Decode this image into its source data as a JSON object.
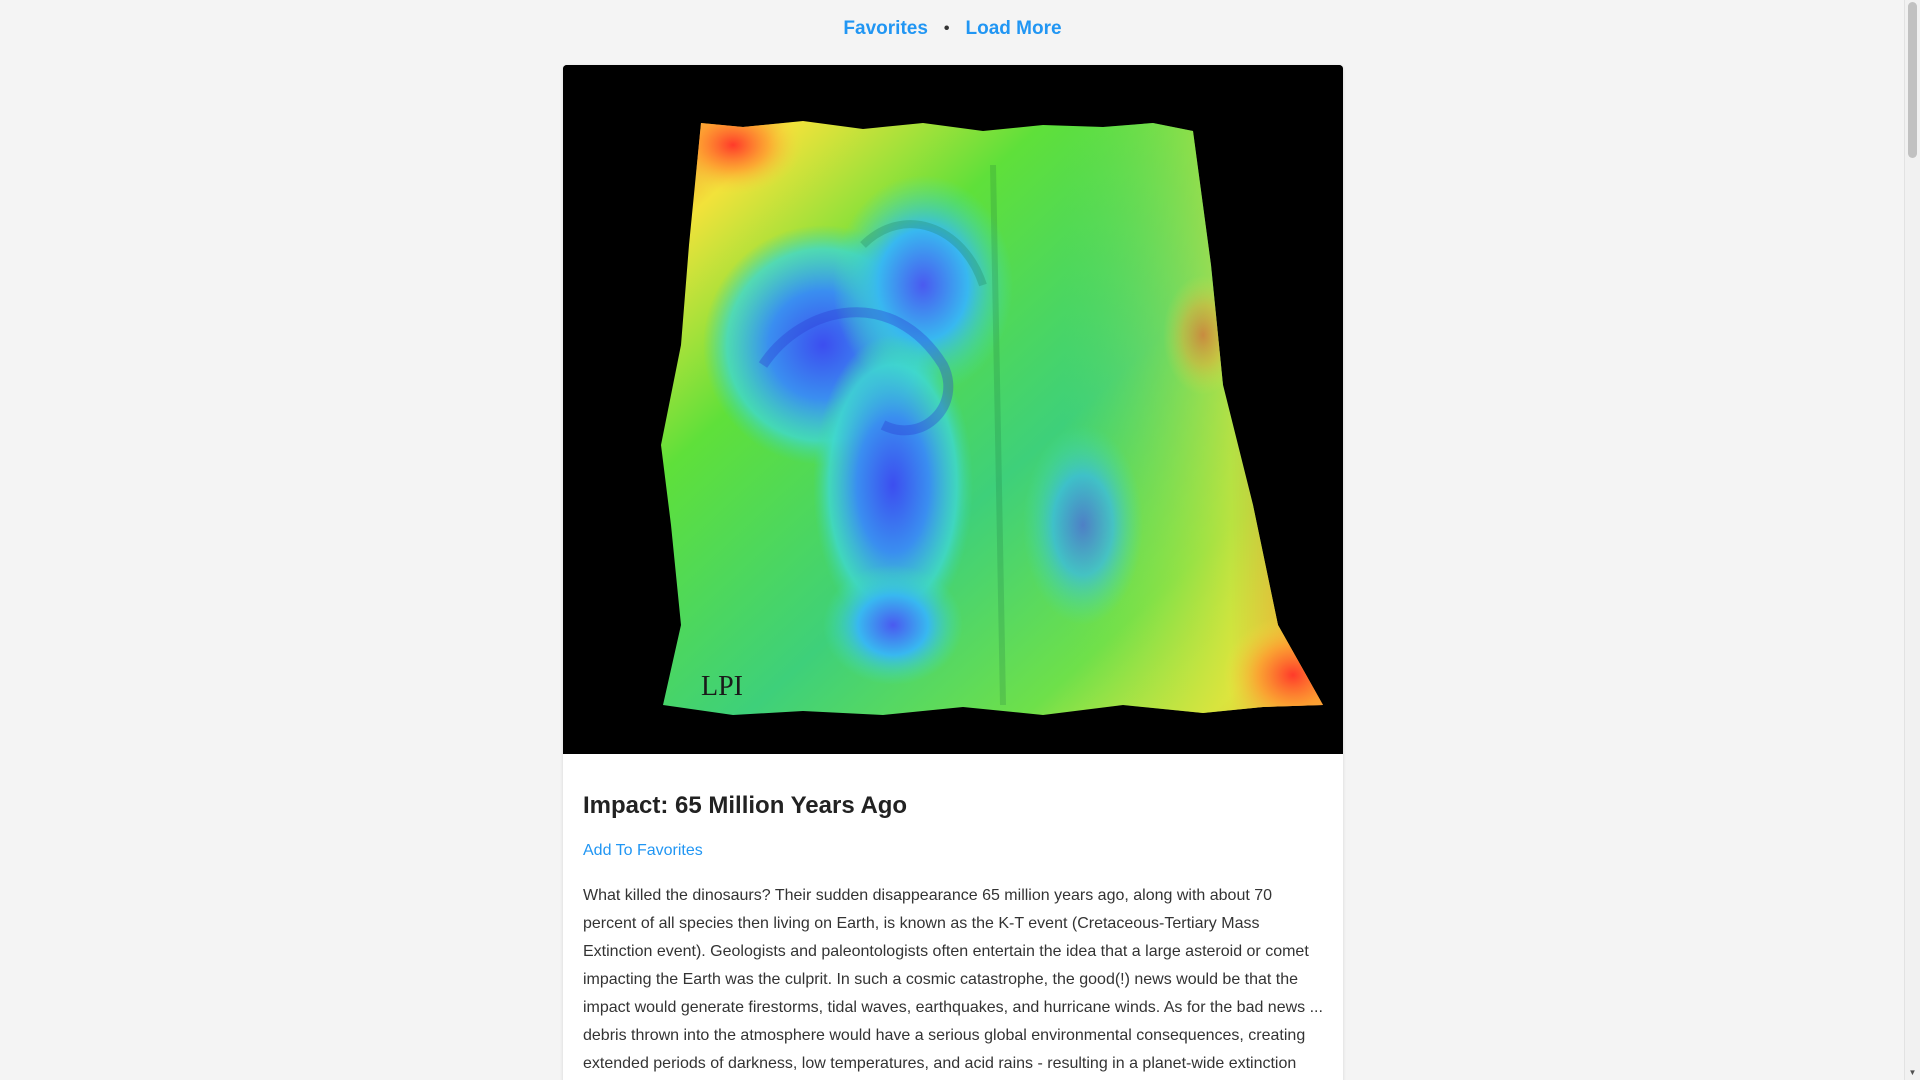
{
  "nav": {
    "favorites_label": "Favorites",
    "separator": "•",
    "load_more_label": "Load More"
  },
  "card": {
    "image": {
      "icon": "terrain-heightmap-image",
      "watermark": "LPI"
    },
    "title": "Impact: 65 Million Years Ago",
    "add_favorites_label": "Add To Favorites",
    "description": "What killed the dinosaurs? Their sudden disappearance 65 million years ago, along with about 70 percent of all species then living on Earth, is known as the K-T event (Cretaceous-Tertiary Mass Extinction event). Geologists and paleontologists often entertain the idea that a large asteroid or comet impacting the Earth was the culprit. In such a cosmic catastrophe, the good(!) news would be that the impact would generate firestorms, tidal waves, earthquakes, and hurricane winds. As for the bad news ... debris thrown into the atmosphere would have a serious global environmental consequences, creating extended periods of darkness, low temperatures, and acid rains - resulting in a planet-wide extinction"
  },
  "colors": {
    "link": "#2196f3",
    "background": "#f4f4f4",
    "card": "#ffffff"
  },
  "scrollbar": {
    "down_arrow_icon": "▼"
  }
}
